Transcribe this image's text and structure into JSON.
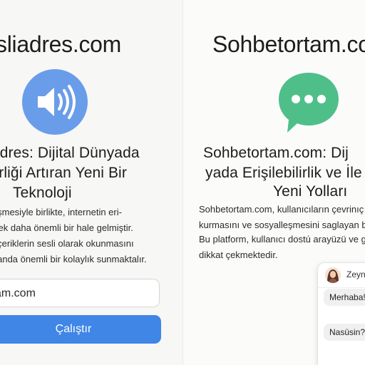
{
  "left": {
    "title": "sliadres.com",
    "headline": [
      "adres: Dijital Dünyada",
      "ilirliği Artıran Yeni Bir",
      "Teknoloji"
    ],
    "body": [
      "elşmesiyle birlikte, internetin eri-",
      "erek daha önemli bir hale gelmiştir.",
      "ı içeriklerin sesli olarak okunmasını",
      "alanda önemli bir kolaylık sunmaktalır."
    ],
    "input_value": "am.com",
    "run_label": "Çalıştır",
    "icon": "speaker-icon",
    "icon_color": "#6a9de9",
    "button_color": "#3f86e6"
  },
  "right": {
    "title": "Sohbetortam.com",
    "headline": [
      "Sohbetortam.com: Dij",
      "yada Erişilebilirlik ve İle",
      "Yeni Yolları"
    ],
    "body": [
      "Sohbetortam.com, kullanıcıların çevrinıç",
      "kurmasını ve sosyalleşmesini saglayan b",
      "Bu platform, kullanıcı dostú arayüzü ve g",
      "dikkat çekmektedir."
    ],
    "icon": "chat-bubble-icon",
    "icon_color": "#4fbf8a",
    "chat": {
      "name": "Zeyne",
      "messages": [
        "Merhaba!",
        "Nasüsin?"
      ]
    }
  }
}
